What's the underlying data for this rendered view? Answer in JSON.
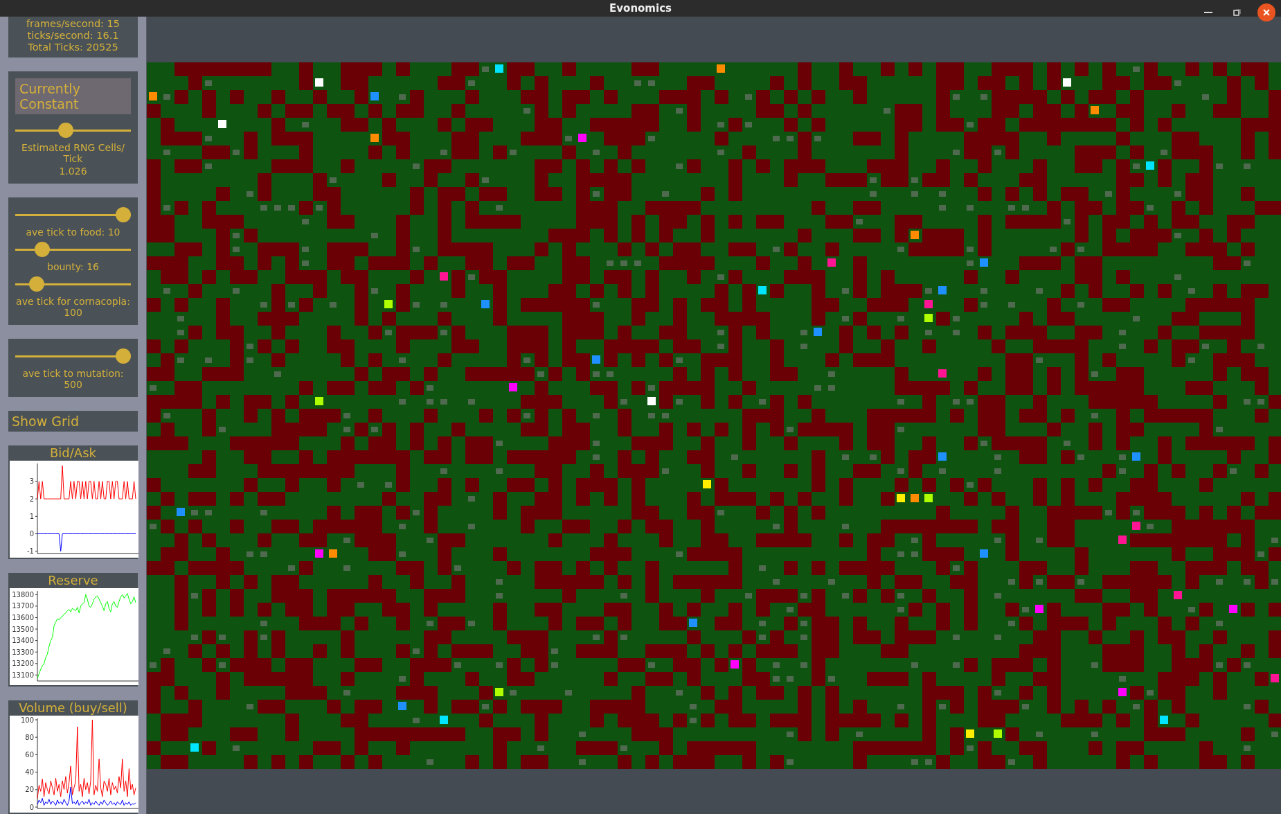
{
  "window": {
    "title": "Evonomics"
  },
  "stats": [
    "frames/second: 15",
    "ticks/second: 16.1",
    "Total Ticks: 20525"
  ],
  "rng_panel": {
    "mode_button": "Currently Constant",
    "slider": {
      "level": 0.43
    },
    "label": "Estimated RNG Cells/ Tick",
    "value": "1.026"
  },
  "slider_panels": [
    {
      "sliders": [
        {
          "level": 1,
          "label": "ave tick to food: 10"
        },
        {
          "level": 0.19,
          "label": "bounty: 16"
        },
        {
          "level": 0.14,
          "label": "ave tick for cornacopia: 100"
        }
      ]
    },
    {
      "sliders": [
        {
          "level": 1,
          "label": "ave tick to mutation: 500"
        }
      ]
    }
  ],
  "show_grid_button": "Show Grid",
  "charts": [
    {
      "title": "Bid/Ask",
      "chart_data": {
        "type": "line",
        "ylim": [
          -1.05,
          3.95
        ],
        "yticks": [
          -1,
          0,
          1,
          2,
          3
        ],
        "series": [
          {
            "color": "#ff0000",
            "values": [
              2,
              3,
              2,
              3,
              2,
              2,
              2,
              2,
              2,
              2,
              2,
              2,
              2,
              2,
              2,
              3.9,
              2,
              2,
              2,
              2,
              3,
              2,
              3,
              2,
              3,
              3,
              2,
              3,
              2,
              3,
              2,
              3,
              3,
              2,
              3,
              2,
              2,
              3,
              2,
              3,
              2,
              2,
              3,
              3,
              2,
              3,
              2,
              3,
              3,
              2,
              2,
              2,
              3,
              2,
              3,
              2,
              2,
              2,
              3,
              2
            ]
          },
          {
            "color": "#0000ff",
            "values": [
              0,
              0,
              0,
              0,
              0,
              0,
              0,
              0,
              0,
              0,
              0,
              0,
              0,
              0,
              -1,
              0,
              0,
              0,
              0,
              0,
              0,
              0,
              0,
              0,
              0,
              0,
              0,
              0,
              0,
              0,
              0,
              0,
              0,
              0,
              0,
              0,
              0,
              0,
              0,
              0,
              0,
              0,
              0,
              0,
              0,
              0,
              0,
              0,
              0,
              0,
              0,
              0,
              0,
              0,
              0,
              0,
              0,
              0,
              0,
              0
            ]
          }
        ]
      }
    },
    {
      "title": "Reserve",
      "chart_data": {
        "type": "line",
        "ylim": [
          13060,
          13820
        ],
        "yticks": [
          13100,
          13200,
          13300,
          13400,
          13500,
          13600,
          13700,
          13800
        ],
        "series": [
          {
            "color": "#00ff00",
            "values": [
              13070,
              13110,
              13150,
              13180,
              13200,
              13250,
              13280,
              13350,
              13400,
              13430,
              13530,
              13560,
              13590,
              13580,
              13600,
              13610,
              13630,
              13640,
              13660,
              13670,
              13650,
              13680,
              13670,
              13660,
              13690,
              13640,
              13700,
              13720,
              13730,
              13800,
              13760,
              13700,
              13690,
              13720,
              13760,
              13780,
              13790,
              13760,
              13730,
              13700,
              13660,
              13720,
              13740,
              13680,
              13650,
              13720,
              13740,
              13700,
              13690,
              13740,
              13780,
              13800,
              13770,
              13790,
              13810,
              13760,
              13720,
              13740,
              13780,
              13730
            ]
          }
        ]
      }
    },
    {
      "title": "Volume (buy/sell)",
      "chart_data": {
        "type": "line",
        "ylim": [
          0,
          100
        ],
        "yticks": [
          0,
          20,
          40,
          60,
          80,
          100
        ],
        "series": [
          {
            "color": "#ff0000",
            "values": [
              10,
              25,
              18,
              32,
              12,
              28,
              20,
              15,
              30,
              22,
              14,
              33,
              18,
              26,
              12,
              30,
              20,
              35,
              16,
              28,
              47,
              14,
              22,
              30,
              92,
              18,
              26,
              12,
              33,
              20,
              28,
              15,
              30,
              100,
              14,
              25,
              18,
              55,
              22,
              12,
              30,
              26,
              18,
              33,
              14,
              28,
              20,
              24,
              16,
              35,
              22,
              55,
              18,
              30,
              12,
              44,
              20,
              26,
              14,
              22
            ]
          },
          {
            "color": "#0000ff",
            "values": [
              3,
              8,
              5,
              10,
              2,
              6,
              4,
              9,
              3,
              7,
              5,
              2,
              8,
              4,
              6,
              3,
              9,
              5,
              2,
              7,
              23,
              4,
              6,
              3,
              8,
              2,
              5,
              7,
              3,
              6,
              4,
              9,
              2,
              5,
              3,
              7,
              4,
              2,
              6,
              3,
              8,
              5,
              2,
              4,
              7,
              3,
              5,
              2,
              6,
              4,
              3,
              8,
              2,
              5,
              3,
              6,
              2,
              4,
              3,
              5
            ]
          }
        ]
      }
    }
  ]
}
